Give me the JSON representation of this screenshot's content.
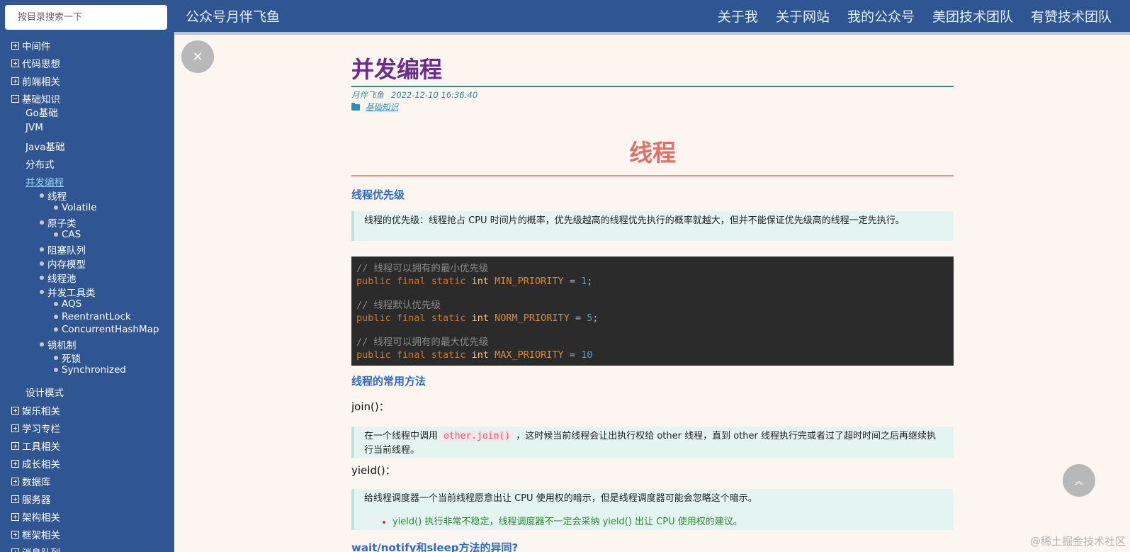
{
  "search": {
    "placeholder": "按目录搜索一下"
  },
  "header": {
    "brand": "公众号月伴飞鱼",
    "nav": [
      "关于我",
      "关于网站",
      "我的公众号",
      "美团技术团队",
      "有赞技术团队"
    ]
  },
  "sidebar": {
    "categories_top": [
      "中间件",
      "代码思想",
      "前端相关"
    ],
    "expanded_category": "基础知识",
    "expanded_items": [
      "Go基础",
      "JVM",
      "Java基础",
      "分布式",
      "并发编程",
      "设计模式"
    ],
    "active_item": "并发编程",
    "toc": [
      {
        "label": "线程",
        "level": 1
      },
      {
        "label": "Volatile",
        "level": 2
      },
      {
        "label": "原子类",
        "level": 1
      },
      {
        "label": "CAS",
        "level": 2
      },
      {
        "label": "阻塞队列",
        "level": 1
      },
      {
        "label": "内存模型",
        "level": 1
      },
      {
        "label": "线程池",
        "level": 1
      },
      {
        "label": "并发工具类",
        "level": 1
      },
      {
        "label": "AQS",
        "level": 2
      },
      {
        "label": "ReentrantLock",
        "level": 2
      },
      {
        "label": "ConcurrentHashMap",
        "level": 2
      },
      {
        "label": "锁机制",
        "level": 1
      },
      {
        "label": "死锁",
        "level": 2
      },
      {
        "label": "Synchronized",
        "level": 2
      }
    ],
    "categories_bottom": [
      "娱乐相关",
      "学习专栏",
      "工具相关",
      "成长相关",
      "数据库",
      "服务器",
      "架构相关",
      "框架相关",
      "消息队列"
    ]
  },
  "article": {
    "title": "并发编程",
    "author": "月伴飞鱼",
    "date": "2022-12-10 16:36:40",
    "category": "基础知识",
    "h1": "线程",
    "sections": {
      "priority_heading": "线程优先级",
      "priority_quote": "线程的优先级：线程抢占 CPU 时间片的概率，优先级越高的线程优先执行的概率就越大，但并不能保证优先级高的线程一定先执行。",
      "methods_heading": "线程的常用方法",
      "join_label": "join()：",
      "join_quote_before": "在一个线程中调用",
      "join_code": "other.join()",
      "join_quote_after": "，这时候当前线程会让出执行权给 other 线程，直到 other 线程执行完或者过了超时时间之后再继续执行当前线程。",
      "yield_label": "yield()：",
      "yield_quote": "给线程调度器一个当前线程愿意出让 CPU 使用权的暗示，但是线程调度器可能会忽略这个暗示。",
      "yield_bullet": "yield() 执行非常不稳定，线程调度器不一定会采纳 yield() 出让 CPU 使用权的建议。",
      "wait_heading": "wait/notify和sleep方法的异同?"
    },
    "code": [
      {
        "comment": "// 线程可以拥有的最小优先级",
        "name": "MIN_PRIORITY",
        "value": "1",
        "semi": ";"
      },
      {
        "comment": "// 线程默认优先级",
        "name": "NORM_PRIORITY",
        "value": "5",
        "semi": ";"
      },
      {
        "comment": "// 线程可以拥有的最大优先级",
        "name": "MAX_PRIORITY",
        "value": "10",
        "semi": ""
      }
    ],
    "code_keywords": {
      "public": "public",
      "final": "final",
      "static": "static",
      "int": "int",
      "eq": "="
    }
  },
  "icons": {
    "close": "close-icon",
    "back_to_top": "chevron-up-icon",
    "folder": "folder-icon"
  },
  "watermark": "@稀土掘金技术社区",
  "colors": {
    "sidebar": "#2f5592",
    "title": "#6b2c91",
    "h1": "#e0706a",
    "heading": "#2d6bc4"
  }
}
